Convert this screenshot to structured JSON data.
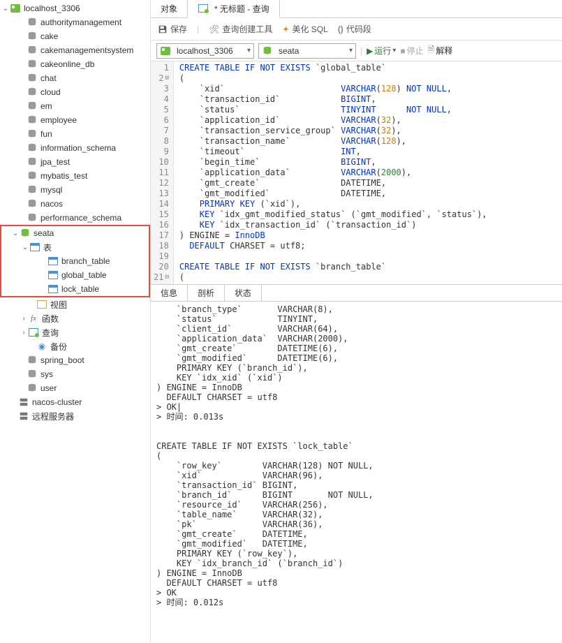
{
  "sidebar": {
    "connection": "localhost_3306",
    "databases": [
      "authoritymanagement",
      "cake",
      "cakemanagementsystem",
      "cakeonline_db",
      "chat",
      "cloud",
      "em",
      "employee",
      "fun",
      "information_schema",
      "jpa_test",
      "mybatis_test",
      "mysql",
      "nacos",
      "performance_schema"
    ],
    "seata": {
      "name": "seata",
      "tables_label": "表",
      "tables": [
        "branch_table",
        "global_table",
        "lock_table"
      ],
      "views": "视图",
      "functions": "函数",
      "queries": "查询",
      "backups": "备份"
    },
    "databases_after": [
      "spring_boot",
      "sys",
      "user"
    ],
    "other_connections": [
      "nacos-cluster",
      "远程服务器"
    ]
  },
  "tabs": {
    "objects": "对象",
    "query": "* 无标题 - 查询"
  },
  "toolbar": {
    "save": "保存",
    "querybuilder": "查询创建工具",
    "beautify": "美化 SQL",
    "codesnippet": "代码段"
  },
  "exec": {
    "connection": "localhost_3306",
    "database": "seata",
    "run": "运行",
    "stop": "停止",
    "explain": "解释"
  },
  "code_lines": [
    {
      "n": 1,
      "html": "<span class='kw'>CREATE TABLE IF NOT EXISTS</span> `global_table`"
    },
    {
      "n": 2,
      "fold": "⊟",
      "html": "("
    },
    {
      "n": 3,
      "html": "    `xid`                       <span class='kw'>VARCHAR</span>(<span class='num'>128</span>) <span class='kw'>NOT NULL</span>,"
    },
    {
      "n": 4,
      "html": "    `transaction_id`            <span class='kw'>BIGINT</span>,"
    },
    {
      "n": 5,
      "html": "    `status`                    <span class='kw'>TINYINT      NOT NULL</span>,"
    },
    {
      "n": 6,
      "html": "    `application_id`            <span class='kw'>VARCHAR</span>(<span class='num'>32</span>),"
    },
    {
      "n": 7,
      "html": "    `transaction_service_group` <span class='kw'>VARCHAR</span>(<span class='num'>32</span>),"
    },
    {
      "n": 8,
      "html": "    `transaction_name`          <span class='kw'>VARCHAR</span>(<span class='num'>128</span>),"
    },
    {
      "n": 9,
      "html": "    `timeout`                   <span class='kw'>INT</span>,"
    },
    {
      "n": 10,
      "html": "    `begin_time`                <span class='kw'>BIGINT</span>,"
    },
    {
      "n": 11,
      "html": "    `application_data`          <span class='kw'>VARCHAR</span>(<span class='num2'>2000</span>),"
    },
    {
      "n": 12,
      "html": "    `gmt_create`                DATETIME,"
    },
    {
      "n": 13,
      "html": "    `gmt_modified`              DATETIME,"
    },
    {
      "n": 14,
      "html": "    <span class='kw'>PRIMARY KEY</span> (`xid`),"
    },
    {
      "n": 15,
      "html": "    <span class='kw'>KEY</span> `idx_gmt_modified_status` (`gmt_modified`, `status`),"
    },
    {
      "n": 16,
      "html": "    <span class='kw'>KEY</span> `idx_transaction_id` (`transaction_id`)"
    },
    {
      "n": 17,
      "html": ") ENGINE = <span class='kw'>InnoDB</span>"
    },
    {
      "n": 18,
      "html": "  <span class='kw'>DEFAULT</span> CHARSET = utf8;"
    },
    {
      "n": 19,
      "html": ""
    },
    {
      "n": 20,
      "html": "<span class='kw'>CREATE TABLE IF NOT EXISTS</span> `branch_table`"
    },
    {
      "n": 21,
      "fold": "⊟",
      "html": "("
    }
  ],
  "result_tabs": {
    "info": "信息",
    "profile": "剖析",
    "status": "状态"
  },
  "output": "    `branch_type`       VARCHAR(8),\n    `status`            TINYINT,\n    `client_id`         VARCHAR(64),\n    `application_data`  VARCHAR(2000),\n    `gmt_create`        DATETIME(6),\n    `gmt_modified`      DATETIME(6),\n    PRIMARY KEY (`branch_id`),\n    KEY `idx_xid` (`xid`)\n) ENGINE = InnoDB\n  DEFAULT CHARSET = utf8\n> OK|\n> 时间: 0.013s\n\n\nCREATE TABLE IF NOT EXISTS `lock_table`\n(\n    `row_key`        VARCHAR(128) NOT NULL,\n    `xid`            VARCHAR(96),\n    `transaction_id` BIGINT,\n    `branch_id`      BIGINT       NOT NULL,\n    `resource_id`    VARCHAR(256),\n    `table_name`     VARCHAR(32),\n    `pk`             VARCHAR(36),\n    `gmt_create`     DATETIME,\n    `gmt_modified`   DATETIME,\n    PRIMARY KEY (`row_key`),\n    KEY `idx_branch_id` (`branch_id`)\n) ENGINE = InnoDB\n  DEFAULT CHARSET = utf8\n> OK\n> 时间: 0.012s\n"
}
